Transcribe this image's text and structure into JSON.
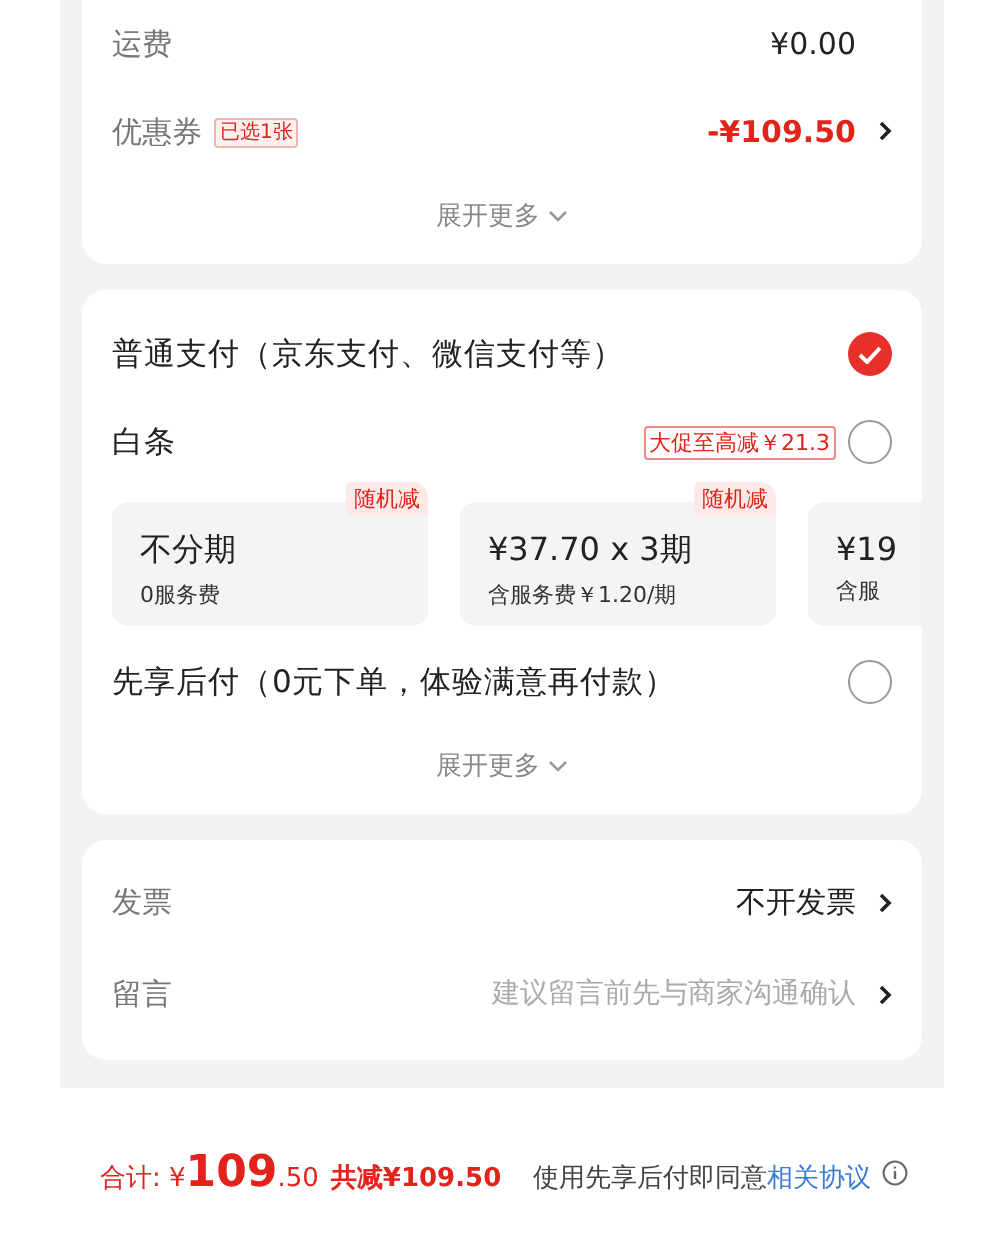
{
  "summary": {
    "rows": [
      {
        "label": "运费",
        "value": "¥0.00",
        "discount": false,
        "has_arrow": false
      },
      {
        "label": "优惠券",
        "tag": "已选1张",
        "value": "-¥109.50",
        "discount": true,
        "has_arrow": true
      }
    ],
    "expand": "展开更多"
  },
  "payment": {
    "options": [
      {
        "label": "普通支付（京东支付、微信支付等）",
        "selected": true
      },
      {
        "label": "白条",
        "promo": "大促至高减￥21.3",
        "selected": false,
        "plans": [
          {
            "title": "不分期",
            "subtitle": "0服务费",
            "badge": "随机减"
          },
          {
            "title": "¥37.70 x 3期",
            "subtitle": "含服务费￥1.20/期",
            "badge": "随机减"
          },
          {
            "title": "¥19",
            "subtitle": "含服"
          }
        ]
      },
      {
        "label": "先享后付（0元下单，体验满意再付款）",
        "selected": false
      }
    ],
    "expand": "展开更多"
  },
  "extras": {
    "rows": [
      {
        "label": "发票",
        "value": "不开发票",
        "muted": false
      },
      {
        "label": "留言",
        "value": "建议留言前先与商家沟通确认",
        "muted": true
      }
    ]
  },
  "footer": {
    "total_label": "合计:",
    "currency": "¥",
    "total_int": "109",
    "total_dec": ".50",
    "saving": "共减¥109.50",
    "notice": "使用先享后付即同意",
    "link": "相关协议"
  }
}
